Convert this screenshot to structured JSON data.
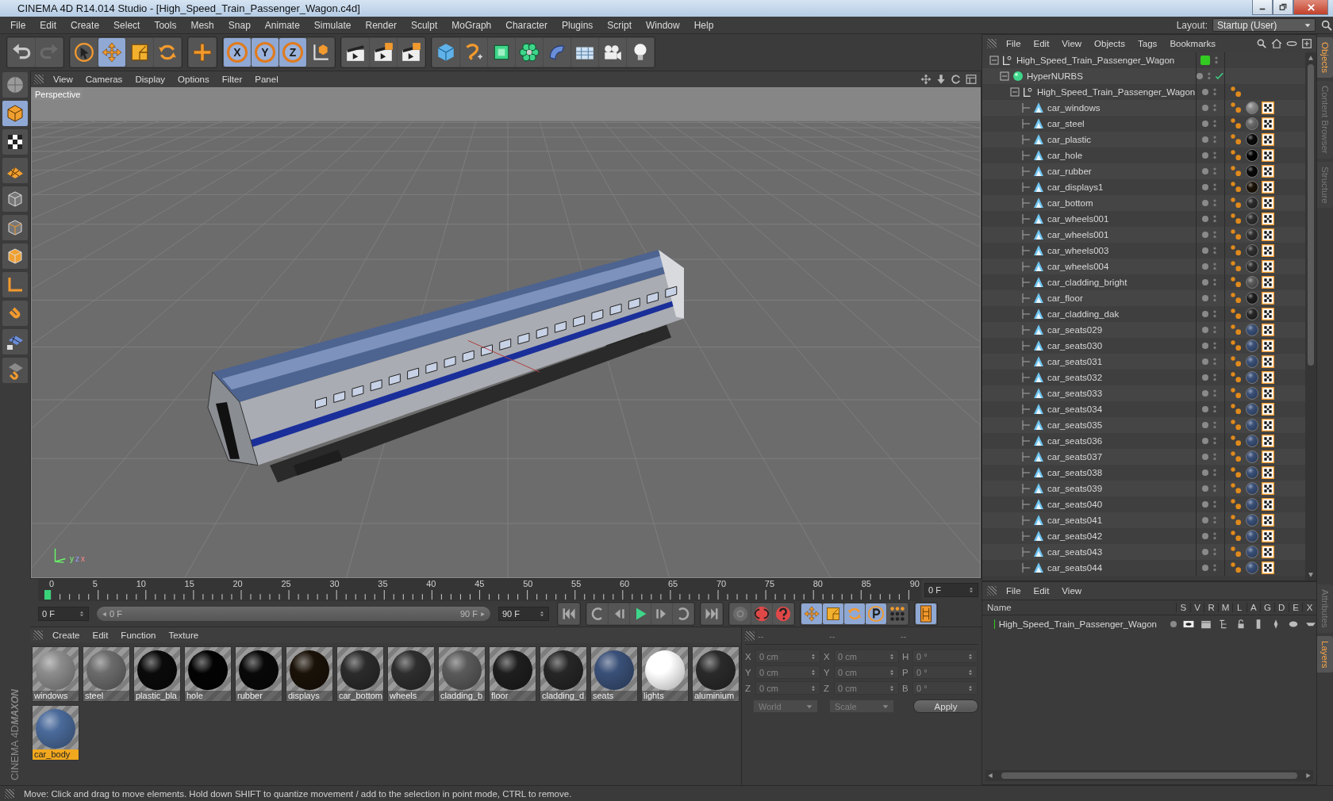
{
  "window": {
    "title": "CINEMA 4D R14.014 Studio - [High_Speed_Train_Passenger_Wagon.c4d]"
  },
  "menu": [
    "File",
    "Edit",
    "Create",
    "Select",
    "Tools",
    "Mesh",
    "Snap",
    "Animate",
    "Simulate",
    "Render",
    "Sculpt",
    "MoGraph",
    "Character",
    "Plugins",
    "Script",
    "Window",
    "Help"
  ],
  "layout": {
    "label": "Layout:",
    "value": "Startup (User)"
  },
  "toolbar": [
    [
      {
        "kind": "undo",
        "selected": false
      },
      {
        "kind": "redo",
        "selected": false
      }
    ],
    [
      {
        "kind": "select",
        "selected": false
      },
      {
        "kind": "move",
        "selected": true
      },
      {
        "kind": "scale",
        "selected": false
      },
      {
        "kind": "rotate",
        "selected": false
      }
    ],
    [
      {
        "kind": "cross",
        "selected": false
      }
    ],
    [
      {
        "kind": "axis",
        "label": "X",
        "selected": true
      },
      {
        "kind": "axis",
        "label": "Y",
        "selected": true
      },
      {
        "kind": "axis",
        "label": "Z",
        "selected": true
      },
      {
        "kind": "coord",
        "selected": false
      }
    ],
    [
      {
        "kind": "render-view",
        "selected": false
      },
      {
        "kind": "render-picture",
        "selected": false
      },
      {
        "kind": "render-settings",
        "selected": false
      }
    ],
    [
      {
        "kind": "cube",
        "selected": false
      },
      {
        "kind": "spline",
        "selected": false
      },
      {
        "kind": "nurbs",
        "selected": false
      },
      {
        "kind": "array",
        "selected": false
      },
      {
        "kind": "deformer",
        "selected": false
      },
      {
        "kind": "floor",
        "selected": false
      },
      {
        "kind": "camera",
        "selected": false
      },
      {
        "kind": "light",
        "selected": false
      }
    ]
  ],
  "tools": [
    {
      "kind": "model",
      "selected": false
    },
    {
      "kind": "object",
      "selected": true
    },
    {
      "kind": "texture",
      "selected": false
    },
    {
      "kind": "workplane",
      "selected": false
    },
    {
      "kind": "points",
      "selected": false
    },
    {
      "kind": "edges",
      "selected": false
    },
    {
      "kind": "polygons",
      "selected": false
    },
    {
      "kind": "axis-mode",
      "selected": false
    },
    {
      "kind": "magnet",
      "selected": false
    },
    {
      "kind": "locked-grid",
      "selected": false
    },
    {
      "kind": "snap",
      "selected": false
    }
  ],
  "viewport": {
    "menu": [
      "View",
      "Cameras",
      "Display",
      "Options",
      "Filter",
      "Panel"
    ],
    "camera": "Perspective",
    "axis_labels": [
      "y",
      "z",
      "x"
    ]
  },
  "timeline": {
    "ticks": [
      "0",
      "5",
      "10",
      "15",
      "20",
      "25",
      "30",
      "35",
      "40",
      "45",
      "50",
      "55",
      "60",
      "65",
      "70",
      "75",
      "80",
      "85",
      "90"
    ],
    "current_frame": "0 F",
    "start": "0 F",
    "range_start": "0 F",
    "range_end": "90 F",
    "range": {
      "level": 1
    },
    "end": "90 F",
    "transport": [
      [
        {
          "kind": "first",
          "selected": false
        }
      ],
      [
        {
          "kind": "prev-key",
          "selected": false
        },
        {
          "kind": "prev-frame",
          "selected": false
        },
        {
          "kind": "play",
          "selected": false
        },
        {
          "kind": "next-frame",
          "selected": false
        },
        {
          "kind": "next-key",
          "selected": false
        }
      ],
      [
        {
          "kind": "last",
          "selected": false
        }
      ],
      [
        {
          "kind": "key-record",
          "selected": false
        },
        {
          "kind": "autokey",
          "selected": false
        },
        {
          "kind": "help",
          "selected": false
        }
      ],
      [
        {
          "kind": "move",
          "selected": true
        },
        {
          "kind": "scale",
          "selected": true
        },
        {
          "kind": "rotate",
          "selected": true
        },
        {
          "kind": "param",
          "selected": true
        },
        {
          "kind": "keygrid",
          "selected": false
        }
      ],
      [
        {
          "kind": "film",
          "selected": true
        }
      ]
    ]
  },
  "materials": {
    "menu": [
      "Create",
      "Edit",
      "Function",
      "Texture"
    ],
    "items": [
      {
        "name": "windows",
        "color": "#8c8c8c",
        "selected": false
      },
      {
        "name": "steel",
        "color": "#6b6b6b",
        "selected": false
      },
      {
        "name": "plastic_bla",
        "color": "#0a0a0a",
        "selected": false
      },
      {
        "name": "hole",
        "color": "#030303",
        "selected": false
      },
      {
        "name": "rubber",
        "color": "#080808",
        "selected": false
      },
      {
        "name": "displays",
        "color": "#1a1208",
        "selected": false
      },
      {
        "name": "car_bottom",
        "color": "#2b2b2b",
        "selected": false
      },
      {
        "name": "wheels",
        "color": "#2e2e2e",
        "selected": false
      },
      {
        "name": "cladding_b",
        "color": "#5a5a5a",
        "selected": false
      },
      {
        "name": "floor",
        "color": "#1e1e1e",
        "selected": false
      },
      {
        "name": "cladding_d",
        "color": "#262626",
        "selected": false
      },
      {
        "name": "seats",
        "color": "#3a5078",
        "selected": false
      },
      {
        "name": "lights",
        "color": "#ffffff",
        "selected": false
      },
      {
        "name": "aluminium",
        "color": "#2a2a2a",
        "selected": false
      },
      {
        "name": "car_body",
        "color": "#4a6a9a",
        "selected": true
      }
    ]
  },
  "coordinates": {
    "headers": [
      "--",
      "--",
      "--"
    ],
    "columns": [
      {
        "rows": [
          {
            "label": "X",
            "value": "0 cm"
          },
          {
            "label": "Y",
            "value": "0 cm"
          },
          {
            "label": "Z",
            "value": "0 cm"
          }
        ]
      },
      {
        "rows": [
          {
            "label": "X",
            "value": "0 cm"
          },
          {
            "label": "Y",
            "value": "0 cm"
          },
          {
            "label": "Z",
            "value": "0 cm"
          }
        ]
      },
      {
        "rows": [
          {
            "label": "H",
            "value": "0 °"
          },
          {
            "label": "P",
            "value": "0 °"
          },
          {
            "label": "B",
            "value": "0 °"
          }
        ]
      }
    ],
    "dropdowns": [
      "World",
      "Scale"
    ],
    "apply": "Apply"
  },
  "objects": {
    "menu": [
      "File",
      "Edit",
      "View",
      "Objects",
      "Tags",
      "Bookmarks"
    ],
    "tree": [
      {
        "name": "High_Speed_Train_Passenger_Wagon",
        "kind": "null",
        "color": "#33cc22",
        "expanded": true,
        "children": [
          {
            "name": "HyperNURBS",
            "kind": "hypernurbs",
            "enabled": true,
            "expanded": true,
            "children": [
              {
                "name": "High_Speed_Train_Passenger_Wagon",
                "kind": "null",
                "expanded": true,
                "tags": [
                  {
                    "kind": "phong"
                  }
                ],
                "children": [
                  {
                    "name": "car_windows",
                    "kind": "polygon",
                    "color": "#8c8c8c",
                    "tags": [
                      {
                        "kind": "phong"
                      },
                      {
                        "kind": "material"
                      },
                      {
                        "kind": "uvw"
                      }
                    ]
                  },
                  {
                    "name": "car_steel",
                    "kind": "polygon",
                    "color": "#6b6b6b",
                    "tags": [
                      {
                        "kind": "phong"
                      },
                      {
                        "kind": "material"
                      },
                      {
                        "kind": "uvw"
                      }
                    ]
                  },
                  {
                    "name": "car_plastic",
                    "kind": "polygon",
                    "color": "#0a0a0a",
                    "tags": [
                      {
                        "kind": "phong"
                      },
                      {
                        "kind": "material"
                      },
                      {
                        "kind": "uvw"
                      }
                    ]
                  },
                  {
                    "name": "car_hole",
                    "kind": "polygon",
                    "color": "#030303",
                    "tags": [
                      {
                        "kind": "phong"
                      },
                      {
                        "kind": "material"
                      },
                      {
                        "kind": "uvw"
                      }
                    ]
                  },
                  {
                    "name": "car_rubber",
                    "kind": "polygon",
                    "color": "#080808",
                    "tags": [
                      {
                        "kind": "phong"
                      },
                      {
                        "kind": "material"
                      },
                      {
                        "kind": "uvw"
                      }
                    ]
                  },
                  {
                    "name": "car_displays1",
                    "kind": "polygon",
                    "color": "#1a1208",
                    "tags": [
                      {
                        "kind": "phong"
                      },
                      {
                        "kind": "material"
                      },
                      {
                        "kind": "uvw"
                      }
                    ]
                  },
                  {
                    "name": "car_bottom",
                    "kind": "polygon",
                    "color": "#2b2b2b",
                    "tags": [
                      {
                        "kind": "phong"
                      },
                      {
                        "kind": "material"
                      },
                      {
                        "kind": "uvw"
                      }
                    ]
                  },
                  {
                    "name": "car_wheels001",
                    "kind": "polygon",
                    "color": "#2e2e2e",
                    "tags": [
                      {
                        "kind": "phong"
                      },
                      {
                        "kind": "material"
                      },
                      {
                        "kind": "uvw"
                      }
                    ]
                  },
                  {
                    "name": "car_wheels001",
                    "kind": "polygon",
                    "color": "#2e2e2e",
                    "tags": [
                      {
                        "kind": "phong"
                      },
                      {
                        "kind": "material"
                      },
                      {
                        "kind": "uvw"
                      }
                    ]
                  },
                  {
                    "name": "car_wheels003",
                    "kind": "polygon",
                    "color": "#2e2e2e",
                    "tags": [
                      {
                        "kind": "phong"
                      },
                      {
                        "kind": "material"
                      },
                      {
                        "kind": "uvw"
                      }
                    ]
                  },
                  {
                    "name": "car_wheels004",
                    "kind": "polygon",
                    "color": "#2e2e2e",
                    "tags": [
                      {
                        "kind": "phong"
                      },
                      {
                        "kind": "material"
                      },
                      {
                        "kind": "uvw"
                      }
                    ]
                  },
                  {
                    "name": "car_cladding_bright",
                    "kind": "polygon",
                    "color": "#5a5a5a",
                    "tags": [
                      {
                        "kind": "phong"
                      },
                      {
                        "kind": "material"
                      },
                      {
                        "kind": "uvw"
                      }
                    ]
                  },
                  {
                    "name": "car_floor",
                    "kind": "polygon",
                    "color": "#1e1e1e",
                    "tags": [
                      {
                        "kind": "phong"
                      },
                      {
                        "kind": "material"
                      },
                      {
                        "kind": "uvw"
                      }
                    ]
                  },
                  {
                    "name": "car_cladding_dak",
                    "kind": "polygon",
                    "color": "#262626",
                    "tags": [
                      {
                        "kind": "phong"
                      },
                      {
                        "kind": "material"
                      },
                      {
                        "kind": "uvw"
                      }
                    ]
                  },
                  {
                    "name": "car_seats029",
                    "kind": "polygon",
                    "color": "#3a5078",
                    "tags": [
                      {
                        "kind": "phong"
                      },
                      {
                        "kind": "material"
                      },
                      {
                        "kind": "uvw"
                      }
                    ]
                  },
                  {
                    "name": "car_seats030",
                    "kind": "polygon",
                    "color": "#3a5078",
                    "tags": [
                      {
                        "kind": "phong"
                      },
                      {
                        "kind": "material"
                      },
                      {
                        "kind": "uvw"
                      }
                    ]
                  },
                  {
                    "name": "car_seats031",
                    "kind": "polygon",
                    "color": "#3a5078",
                    "tags": [
                      {
                        "kind": "phong"
                      },
                      {
                        "kind": "material"
                      },
                      {
                        "kind": "uvw"
                      }
                    ]
                  },
                  {
                    "name": "car_seats032",
                    "kind": "polygon",
                    "color": "#3a5078",
                    "tags": [
                      {
                        "kind": "phong"
                      },
                      {
                        "kind": "material"
                      },
                      {
                        "kind": "uvw"
                      }
                    ]
                  },
                  {
                    "name": "car_seats033",
                    "kind": "polygon",
                    "color": "#3a5078",
                    "tags": [
                      {
                        "kind": "phong"
                      },
                      {
                        "kind": "material"
                      },
                      {
                        "kind": "uvw"
                      }
                    ]
                  },
                  {
                    "name": "car_seats034",
                    "kind": "polygon",
                    "color": "#3a5078",
                    "tags": [
                      {
                        "kind": "phong"
                      },
                      {
                        "kind": "material"
                      },
                      {
                        "kind": "uvw"
                      }
                    ]
                  },
                  {
                    "name": "car_seats035",
                    "kind": "polygon",
                    "color": "#3a5078",
                    "tags": [
                      {
                        "kind": "phong"
                      },
                      {
                        "kind": "material"
                      },
                      {
                        "kind": "uvw"
                      }
                    ]
                  },
                  {
                    "name": "car_seats036",
                    "kind": "polygon",
                    "color": "#3a5078",
                    "tags": [
                      {
                        "kind": "phong"
                      },
                      {
                        "kind": "material"
                      },
                      {
                        "kind": "uvw"
                      }
                    ]
                  },
                  {
                    "name": "car_seats037",
                    "kind": "polygon",
                    "color": "#3a5078",
                    "tags": [
                      {
                        "kind": "phong"
                      },
                      {
                        "kind": "material"
                      },
                      {
                        "kind": "uvw"
                      }
                    ]
                  },
                  {
                    "name": "car_seats038",
                    "kind": "polygon",
                    "color": "#3a5078",
                    "tags": [
                      {
                        "kind": "phong"
                      },
                      {
                        "kind": "material"
                      },
                      {
                        "kind": "uvw"
                      }
                    ]
                  },
                  {
                    "name": "car_seats039",
                    "kind": "polygon",
                    "color": "#3a5078",
                    "tags": [
                      {
                        "kind": "phong"
                      },
                      {
                        "kind": "material"
                      },
                      {
                        "kind": "uvw"
                      }
                    ]
                  },
                  {
                    "name": "car_seats040",
                    "kind": "polygon",
                    "color": "#3a5078",
                    "tags": [
                      {
                        "kind": "phong"
                      },
                      {
                        "kind": "material"
                      },
                      {
                        "kind": "uvw"
                      }
                    ]
                  },
                  {
                    "name": "car_seats041",
                    "kind": "polygon",
                    "color": "#3a5078",
                    "tags": [
                      {
                        "kind": "phong"
                      },
                      {
                        "kind": "material"
                      },
                      {
                        "kind": "uvw"
                      }
                    ]
                  },
                  {
                    "name": "car_seats042",
                    "kind": "polygon",
                    "color": "#3a5078",
                    "tags": [
                      {
                        "kind": "phong"
                      },
                      {
                        "kind": "material"
                      },
                      {
                        "kind": "uvw"
                      }
                    ]
                  },
                  {
                    "name": "car_seats043",
                    "kind": "polygon",
                    "color": "#3a5078",
                    "tags": [
                      {
                        "kind": "phong"
                      },
                      {
                        "kind": "material"
                      },
                      {
                        "kind": "uvw"
                      }
                    ]
                  },
                  {
                    "name": "car_seats044",
                    "kind": "polygon",
                    "color": "#3a5078",
                    "tags": [
                      {
                        "kind": "phong"
                      },
                      {
                        "kind": "material"
                      },
                      {
                        "kind": "uvw"
                      }
                    ]
                  }
                ]
              }
            ]
          }
        ]
      }
    ]
  },
  "side_tabs_top": [
    {
      "label": "Objects",
      "selected": true
    },
    {
      "label": "Content Browser",
      "selected": false
    },
    {
      "label": "Structure",
      "selected": false
    }
  ],
  "layers": {
    "menu": [
      "File",
      "Edit",
      "View"
    ],
    "columns": [
      "Name",
      "S",
      "V",
      "R",
      "M",
      "L",
      "A",
      "G",
      "D",
      "E",
      "X"
    ],
    "rows": [
      {
        "name": "High_Speed_Train_Passenger_Wagon",
        "color": "#33cc22"
      }
    ]
  },
  "side_tabs_bottom": [
    {
      "label": "Attributes",
      "selected": false
    },
    {
      "label": "Layers",
      "selected": true
    }
  ],
  "logo": {
    "brand": "MAXON",
    "product": "CINEMA 4D"
  },
  "status": "Move: Click and drag to move elements. Hold down SHIFT to quantize movement / add to the selection in point mode, CTRL to remove."
}
